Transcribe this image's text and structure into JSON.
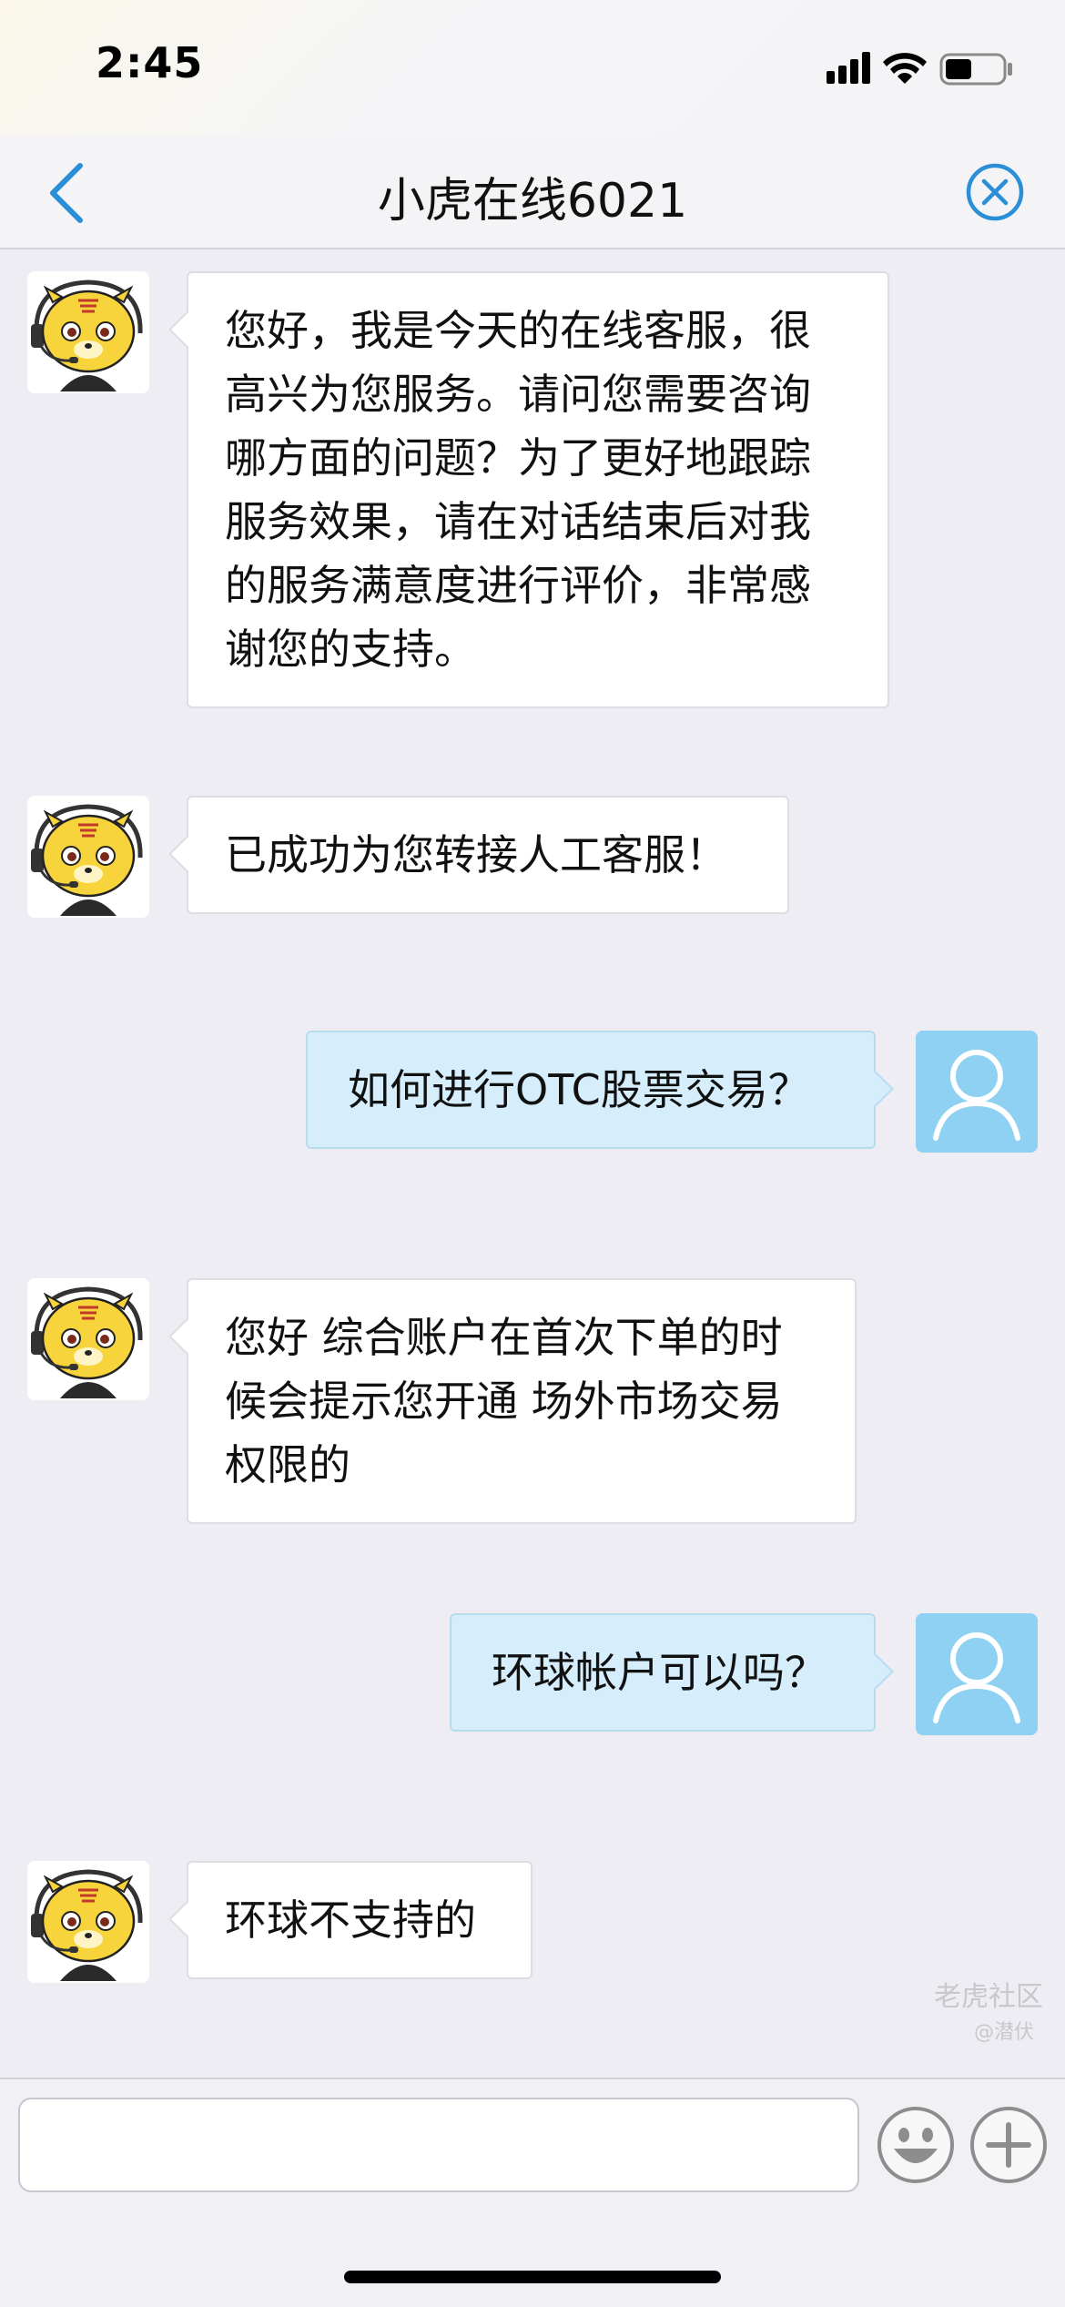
{
  "status_bar": {
    "time": "2:45"
  },
  "header": {
    "title": "小虎在线6021"
  },
  "messages": [
    {
      "sender": "agent",
      "text": "您好，我是今天的在线客服，很高兴为您服务。请问您需要咨询哪方面的问题？为了更好地跟踪服务效果，请在对话结束后对我的服务满意度进行评价，非常感谢您的支持。"
    },
    {
      "sender": "agent",
      "text": "已成功为您转接人工客服！"
    },
    {
      "sender": "user",
      "text": "如何进行OTC股票交易？"
    },
    {
      "sender": "agent",
      "text": "您好 综合账户在首次下单的时候会提示您开通 场外市场交易权限的"
    },
    {
      "sender": "user",
      "text": "环球帐户可以吗？"
    },
    {
      "sender": "agent",
      "text": "环球不支持的"
    }
  ],
  "input": {
    "value": "",
    "placeholder": ""
  },
  "watermark": {
    "main": "老虎社区",
    "sub": "@潜伏"
  },
  "colors": {
    "accent": "#2b8fd8",
    "user_bubble": "#d6eefb",
    "agent_bubble": "#ffffff",
    "user_avatar": "#8fd1f2",
    "tiger_yellow": "#f8d43c"
  },
  "icons": {
    "back": "chevron-left-icon",
    "close": "close-circle-icon",
    "emoji": "smiley-icon",
    "plus": "plus-circle-icon",
    "agent_avatar": "tiger-headset-avatar",
    "user_avatar": "person-outline-avatar"
  }
}
